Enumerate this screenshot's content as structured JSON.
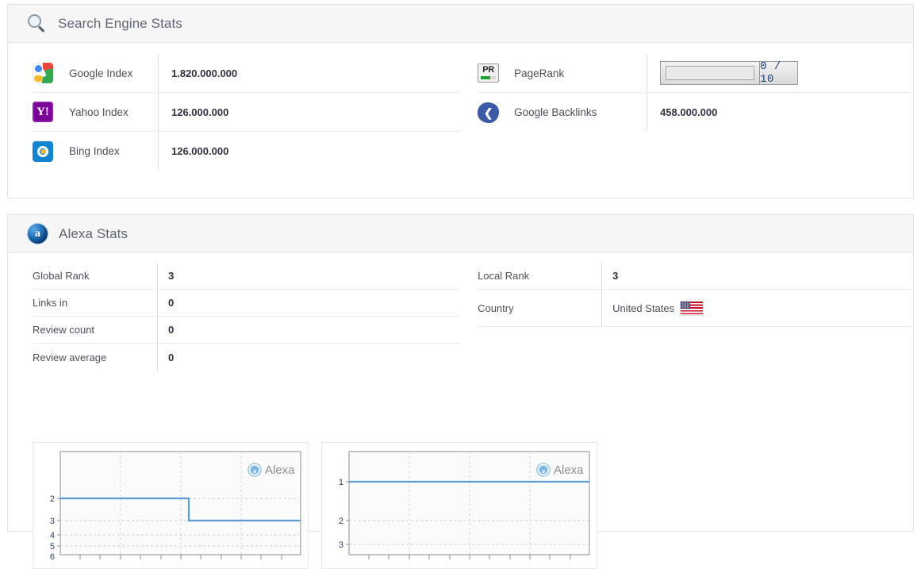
{
  "search_panel": {
    "title": "Search Engine Stats",
    "icon": "search-icon",
    "left_rows": [
      {
        "icon": "google-icon",
        "label": "Google Index",
        "value": "1.820.000.000"
      },
      {
        "icon": "yahoo-icon",
        "label": "Yahoo Index",
        "value": "126.000.000"
      },
      {
        "icon": "bing-icon",
        "label": "Bing Index",
        "value": "126.000.000"
      }
    ],
    "right_rows": [
      {
        "icon": "pagerank-icon",
        "label": "PageRank",
        "value": "0 / 10",
        "widget": "pagerank-bar"
      },
      {
        "icon": "share-icon",
        "label": "Google Backlinks",
        "value": "458.000.000"
      }
    ],
    "pagerank": {
      "score_text": "0 / 10",
      "value": 0,
      "max": 10,
      "fill_percent": 0
    }
  },
  "alexa_panel": {
    "title": "Alexa Stats",
    "icon": "alexa-icon",
    "left_rows": [
      {
        "label": "Global Rank",
        "value": "3"
      },
      {
        "label": "Links in",
        "value": "0"
      },
      {
        "label": "Review count",
        "value": "0"
      },
      {
        "label": "Review average",
        "value": "0"
      }
    ],
    "right_rows": [
      {
        "label": "Local Rank",
        "value": "3"
      },
      {
        "label": "Country",
        "value": "United States",
        "flag": "us-flag-icon"
      }
    ]
  },
  "colors": {
    "panel_border": "#e2e2e2",
    "panel_header_bg": "#f6f6f6",
    "row_divider": "#ececec",
    "chart_line": "#5a9bd8",
    "text": "#4a4f5a",
    "value_text": "#2f3340",
    "pagerank_score": "#1d3f7a"
  },
  "chart_data": [
    {
      "type": "line",
      "title": "",
      "watermark": "Alexa",
      "xlabel": "",
      "ylabel": "",
      "y_ticks": [
        2,
        3,
        4,
        5,
        6
      ],
      "y_tick_labels": [
        "2",
        "3",
        "4",
        "5",
        "6"
      ],
      "y_inverted": true,
      "ylim": [
        6,
        1.45
      ],
      "x": [
        0,
        0.47,
        0.47,
        1
      ],
      "values": [
        2,
        2,
        3,
        3
      ],
      "x_tick_count": 12,
      "grid": true,
      "legend": "none",
      "series": [
        {
          "name": "Global Rank",
          "values": [
            2,
            2,
            3,
            3
          ]
        }
      ]
    },
    {
      "type": "line",
      "title": "",
      "watermark": "Alexa",
      "xlabel": "",
      "ylabel": "",
      "y_ticks": [
        1,
        2,
        3
      ],
      "y_tick_labels": [
        "1",
        "2",
        "3"
      ],
      "y_inverted": true,
      "ylim": [
        3.4,
        0.7
      ],
      "x": [
        0,
        1
      ],
      "values": [
        1,
        1
      ],
      "x_tick_count": 12,
      "grid": true,
      "legend": "none",
      "series": [
        {
          "name": "Local Rank",
          "values": [
            1,
            1
          ]
        }
      ]
    }
  ]
}
